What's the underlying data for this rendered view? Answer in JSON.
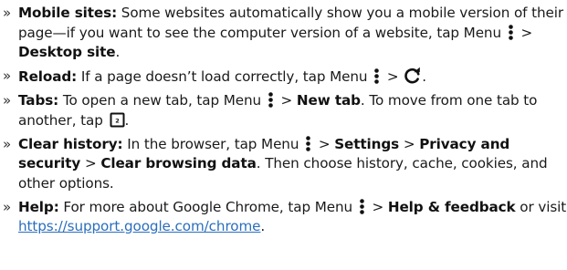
{
  "tips": {
    "bullet": "»",
    "mobile": {
      "label": "Mobile sites:",
      "text_1": " Some websites automatically show you a mobile version of their page—if you want to see the computer version of a website, tap Menu",
      "sep": " > ",
      "bold_1": "Desktop site",
      "end": "."
    },
    "reload": {
      "label": "Reload:",
      "text_1": " If a page doesn’t load correctly, tap Menu",
      "sep": " > ",
      "end": "."
    },
    "tabs": {
      "label": "Tabs:",
      "text_1": " To open a new tab, tap Menu",
      "sep": " > ",
      "bold_1": "New tab",
      "text_2": ". To move from one tab to another, tap",
      "end": ".",
      "tab_count": "2"
    },
    "clear": {
      "label": "Clear history:",
      "text_1": " In the browser, tap Menu",
      "sep": " > ",
      "bold_1": "Settings",
      "sep_2": " > ",
      "bold_2": "Privacy and security",
      "sep_3": " > ",
      "bold_3": "Clear browsing data",
      "text_2": ". Then choose history, cache, cookies, and other options."
    },
    "help": {
      "label": "Help:",
      "text_1": " For more about Google Chrome, tap Menu",
      "sep": " > ",
      "bold_1": "Help & feedback",
      "text_2": " or visit ",
      "link": "https://support.google.com/chrome",
      "end": "."
    }
  },
  "icons": {
    "menu": "more-vert-icon",
    "reload": "reload-icon",
    "tab_switch": "tab-switcher-icon"
  },
  "colors": {
    "text": "#1a1a1a",
    "link": "#2a6ebd"
  }
}
